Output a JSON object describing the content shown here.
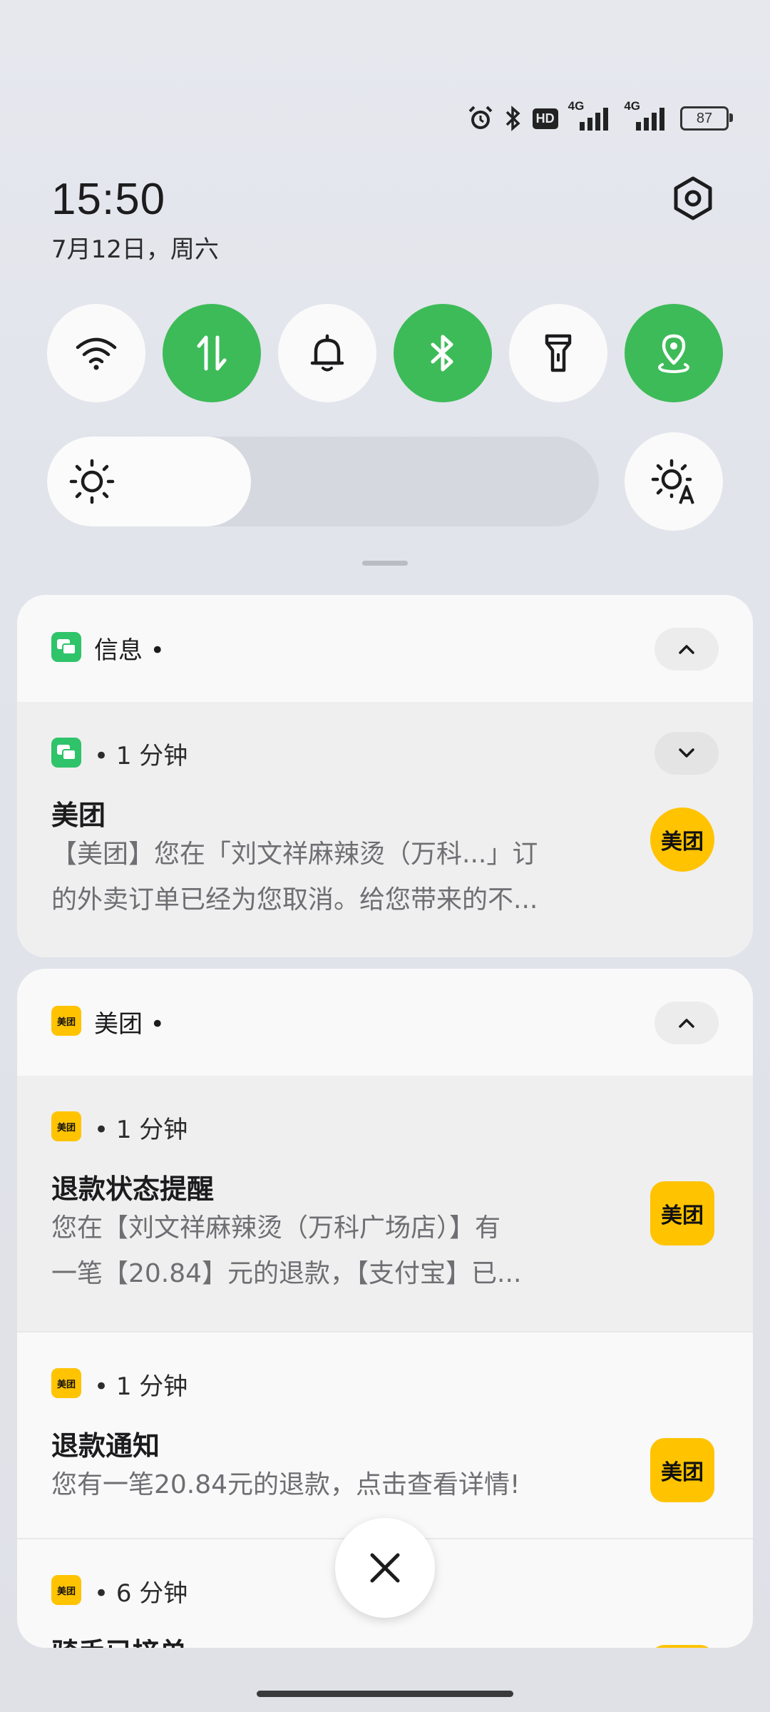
{
  "status_bar": {
    "icons": [
      "alarm-icon",
      "bluetooth-icon",
      "hd-icon",
      "signal-4g-icon",
      "signal-4g-icon"
    ],
    "hd_label": "HD",
    "net1": "4G",
    "net2": "4G",
    "battery": "87"
  },
  "header": {
    "time": "15:50",
    "date": "7月12日，周六"
  },
  "quick_tiles": [
    {
      "name": "wifi",
      "on": false
    },
    {
      "name": "mobile-data",
      "on": true
    },
    {
      "name": "ring",
      "on": false
    },
    {
      "name": "bluetooth",
      "on": true
    },
    {
      "name": "flashlight",
      "on": false
    },
    {
      "name": "location",
      "on": true
    }
  ],
  "brightness": {
    "level": 0.37
  },
  "colors": {
    "accent_green": "#3dbb58",
    "meituan_yellow": "#ffc300",
    "messages_green": "#2fc36a"
  },
  "groups": [
    {
      "app": "信息 •",
      "notifications": [
        {
          "meta": "• 1 分钟",
          "title": "美团",
          "lines": [
            "【美团】您在「刘文祥麻辣烫（万科...」订",
            "的外卖订单已经为您取消。给您带来的不..."
          ],
          "thumb": "美团"
        }
      ]
    },
    {
      "app": "美团 •",
      "icon_label": "美团",
      "notifications": [
        {
          "meta": "• 1 分钟",
          "title": "退款状态提醒",
          "lines": [
            "您在【刘文祥麻辣烫（万科广场店）】有",
            "一笔【20.84】元的退款，【支付宝】已..."
          ],
          "thumb": "美团"
        },
        {
          "meta": "• 1 分钟",
          "title": "退款通知",
          "lines": [
            "您有一笔20.84元的退款，点击查看详情!"
          ],
          "thumb": "美团"
        },
        {
          "meta": "• 6 分钟",
          "title": "骑手已接单",
          "lines": [],
          "thumb": "美团"
        }
      ]
    }
  ]
}
